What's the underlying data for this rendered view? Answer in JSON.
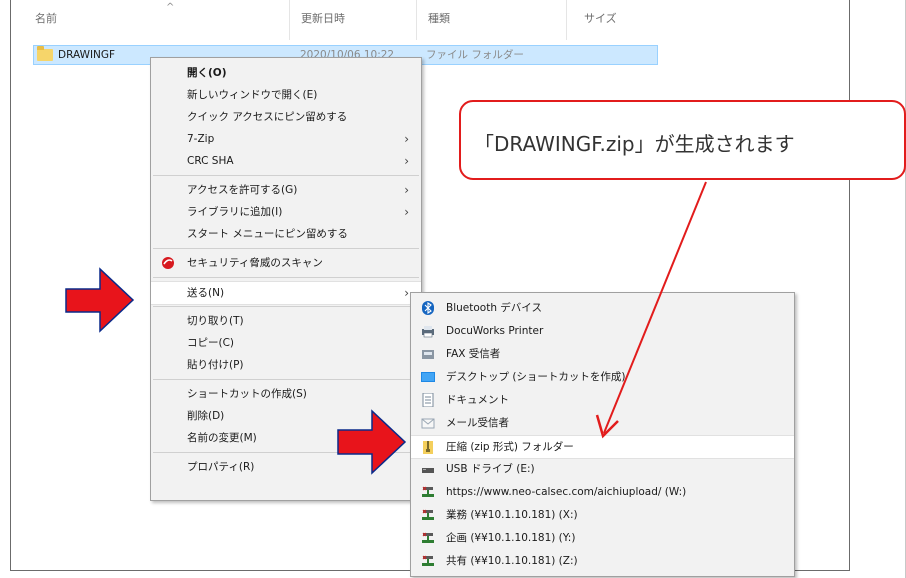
{
  "explorer": {
    "columns": {
      "name": "名前",
      "modified": "更新日時",
      "type": "種類",
      "size": "サイズ"
    },
    "sort_indicator": "^",
    "file": {
      "name": "DRAWINGF",
      "modified": "2020/10/06 10:22",
      "type": "ファイル フォルダー"
    }
  },
  "context_menu": {
    "groups": [
      [
        {
          "label": "開く(O)",
          "bold": true
        },
        {
          "label": "新しいウィンドウで開く(E)"
        },
        {
          "label": "クイック アクセスにピン留めする"
        },
        {
          "label": "7-Zip",
          "submenu": true
        },
        {
          "label": "CRC SHA",
          "submenu": true
        }
      ],
      [
        {
          "label": "アクセスを許可する(G)",
          "submenu": true
        },
        {
          "label": "ライブラリに追加(I)",
          "submenu": true
        },
        {
          "label": "スタート メニューにピン留めする"
        }
      ],
      [
        {
          "label": "セキュリティ脅威のスキャン",
          "icon": "security-scan-icon"
        }
      ],
      [
        {
          "label": "送る(N)",
          "submenu": true,
          "highlighted": true
        }
      ],
      [
        {
          "label": "切り取り(T)"
        },
        {
          "label": "コピー(C)"
        },
        {
          "label": "貼り付け(P)"
        }
      ],
      [
        {
          "label": "ショートカットの作成(S)"
        },
        {
          "label": "削除(D)"
        },
        {
          "label": "名前の変更(M)"
        }
      ],
      [
        {
          "label": "プロパティ(R)"
        }
      ]
    ],
    "chevron": "›"
  },
  "send_to_menu": {
    "items": [
      {
        "label": "Bluetooth デバイス",
        "icon": "bluetooth-icon"
      },
      {
        "label": "DocuWorks Printer",
        "icon": "printer-icon"
      },
      {
        "label": "FAX 受信者",
        "icon": "fax-icon"
      },
      {
        "label": "デスクトップ (ショートカットを作成)",
        "icon": "desktop-icon"
      },
      {
        "label": "ドキュメント",
        "icon": "document-icon"
      },
      {
        "label": "メール受信者",
        "icon": "mail-icon"
      },
      {
        "label": "圧縮 (zip 形式) フォルダー",
        "icon": "zip-folder-icon",
        "highlighted": true
      },
      {
        "label": "USB ドライブ (E:)",
        "icon": "usb-drive-icon"
      },
      {
        "label": "https://www.neo-calsec.com/aichiupload/ (W:)",
        "icon": "network-drive-icon"
      },
      {
        "label": "業務 (¥¥10.1.10.181) (X:)",
        "icon": "network-drive-icon"
      },
      {
        "label": "企画 (¥¥10.1.10.181) (Y:)",
        "icon": "network-drive-icon"
      },
      {
        "label": "共有 (¥¥10.1.10.181) (Z:)",
        "icon": "network-drive-icon"
      }
    ]
  },
  "callout": {
    "text": "「DRAWINGF.zip」が生成されます"
  },
  "colors": {
    "accent_red": "#e21c1c",
    "selection": "#cce8ff"
  }
}
